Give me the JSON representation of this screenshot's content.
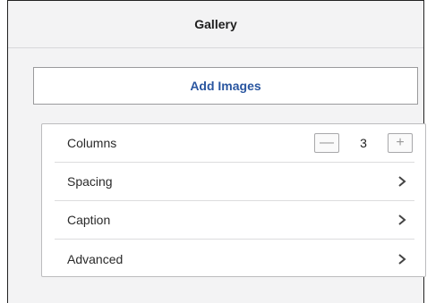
{
  "header": {
    "title": "Gallery"
  },
  "actions": {
    "add_images_label": "Add Images"
  },
  "settings": {
    "columns": {
      "label": "Columns",
      "value": "3",
      "decrement_symbol": "—",
      "increment_symbol": "+"
    },
    "rows": [
      {
        "label": "Spacing",
        "icon": "chevron-right-icon"
      },
      {
        "label": "Caption",
        "icon": "chevron-right-icon"
      },
      {
        "label": "Advanced",
        "icon": "chevron-right-icon"
      }
    ]
  },
  "colors": {
    "accent": "#2a56a0",
    "panel_bg": "#f3f3f4",
    "card_bg": "#ffffff"
  }
}
